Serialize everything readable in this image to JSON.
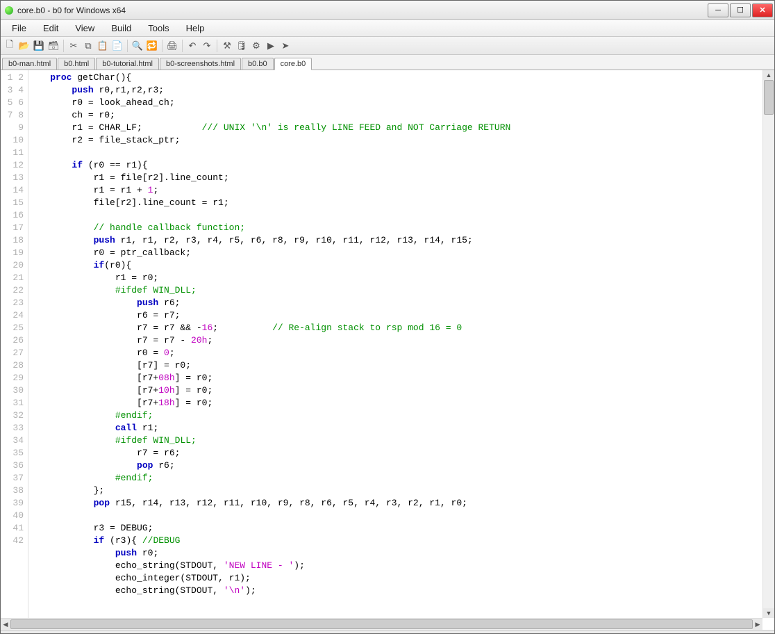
{
  "window": {
    "title": "core.b0 - b0 for Windows x64"
  },
  "menu": {
    "items": [
      "File",
      "Edit",
      "View",
      "Build",
      "Tools",
      "Help"
    ]
  },
  "toolbar_icons": [
    "new",
    "open",
    "save",
    "saveall",
    "|",
    "cut",
    "copy",
    "paste",
    "paste2",
    "|",
    "find",
    "replace",
    "|",
    "print",
    "|",
    "undo",
    "redo",
    "|",
    "compile",
    "db",
    "settings",
    "run",
    "debug"
  ],
  "tabs": {
    "items": [
      "b0-man.html",
      "b0.html",
      "b0-tutorial.html",
      "b0-screenshots.html",
      "b0.b0",
      "core.b0"
    ],
    "active_index": 5
  },
  "first_line_number": 1,
  "code_lines": [
    [
      [
        "",
        "    "
      ],
      [
        "kw",
        "proc"
      ],
      [
        "",
        " getChar(){"
      ]
    ],
    [
      [
        "",
        "        "
      ],
      [
        "kw",
        "push"
      ],
      [
        "",
        " r0,r1,r2,r3;"
      ]
    ],
    [
      [
        "",
        "        r0 = look_ahead_ch;"
      ]
    ],
    [
      [
        "",
        "        ch = r0;"
      ]
    ],
    [
      [
        "",
        "        r1 = CHAR_LF;           "
      ],
      [
        "cmt",
        "/// UNIX '\\n' is really LINE FEED and NOT Carriage RETURN"
      ]
    ],
    [
      [
        "",
        "        r2 = file_stack_ptr;"
      ]
    ],
    [
      [
        "",
        ""
      ]
    ],
    [
      [
        "",
        "        "
      ],
      [
        "kw",
        "if"
      ],
      [
        "",
        " (r0 == r1){"
      ]
    ],
    [
      [
        "",
        "            r1 = file[r2].line_count;"
      ]
    ],
    [
      [
        "",
        "            r1 = r1 + "
      ],
      [
        "num",
        "1"
      ],
      [
        "",
        ";"
      ]
    ],
    [
      [
        "",
        "            file[r2].line_count = r1;"
      ]
    ],
    [
      [
        "",
        ""
      ]
    ],
    [
      [
        "",
        "            "
      ],
      [
        "cmt",
        "// handle callback function;"
      ]
    ],
    [
      [
        "",
        "            "
      ],
      [
        "kw",
        "push"
      ],
      [
        "",
        " r1, r1, r2, r3, r4, r5, r6, r8, r9, r10, r11, r12, r13, r14, r15;"
      ]
    ],
    [
      [
        "",
        "            r0 = ptr_callback;"
      ]
    ],
    [
      [
        "",
        "            "
      ],
      [
        "kw",
        "if"
      ],
      [
        "",
        "(r0){"
      ]
    ],
    [
      [
        "",
        "                r1 = r0;"
      ]
    ],
    [
      [
        "",
        "                "
      ],
      [
        "pre",
        "#ifdef WIN_DLL;"
      ]
    ],
    [
      [
        "",
        "                    "
      ],
      [
        "kw",
        "push"
      ],
      [
        "",
        " r6;"
      ]
    ],
    [
      [
        "",
        "                    r6 = r7;"
      ]
    ],
    [
      [
        "",
        "                    r7 = r7 && -"
      ],
      [
        "num",
        "16"
      ],
      [
        "",
        ";          "
      ],
      [
        "cmt",
        "// Re-align stack to rsp mod 16 = 0"
      ]
    ],
    [
      [
        "",
        "                    r7 = r7 - "
      ],
      [
        "num",
        "20h"
      ],
      [
        "",
        ";"
      ]
    ],
    [
      [
        "",
        "                    r0 = "
      ],
      [
        "num",
        "0"
      ],
      [
        "",
        ";"
      ]
    ],
    [
      [
        "",
        "                    [r7] = r0;"
      ]
    ],
    [
      [
        "",
        "                    [r7+"
      ],
      [
        "num",
        "08h"
      ],
      [
        "",
        "] = r0;"
      ]
    ],
    [
      [
        "",
        "                    [r7+"
      ],
      [
        "num",
        "10h"
      ],
      [
        "",
        "] = r0;"
      ]
    ],
    [
      [
        "",
        "                    [r7+"
      ],
      [
        "num",
        "18h"
      ],
      [
        "",
        "] = r0;"
      ]
    ],
    [
      [
        "",
        "                "
      ],
      [
        "pre",
        "#endif;"
      ]
    ],
    [
      [
        "",
        "                "
      ],
      [
        "kw",
        "call"
      ],
      [
        "",
        " r1;"
      ]
    ],
    [
      [
        "",
        "                "
      ],
      [
        "pre",
        "#ifdef WIN_DLL;"
      ]
    ],
    [
      [
        "",
        "                    r7 = r6;"
      ]
    ],
    [
      [
        "",
        "                    "
      ],
      [
        "kw",
        "pop"
      ],
      [
        "",
        " r6;"
      ]
    ],
    [
      [
        "",
        "                "
      ],
      [
        "pre",
        "#endif;"
      ]
    ],
    [
      [
        "",
        "            };"
      ]
    ],
    [
      [
        "",
        "            "
      ],
      [
        "kw",
        "pop"
      ],
      [
        "",
        " r15, r14, r13, r12, r11, r10, r9, r8, r6, r5, r4, r3, r2, r1, r0;"
      ]
    ],
    [
      [
        "",
        ""
      ]
    ],
    [
      [
        "",
        "            r3 = DEBUG;"
      ]
    ],
    [
      [
        "",
        "            "
      ],
      [
        "kw",
        "if"
      ],
      [
        "",
        " (r3){ "
      ],
      [
        "cmt",
        "//DEBUG"
      ]
    ],
    [
      [
        "",
        "                "
      ],
      [
        "kw",
        "push"
      ],
      [
        "",
        " r0;"
      ]
    ],
    [
      [
        "",
        "                echo_string(STDOUT, "
      ],
      [
        "str",
        "'NEW LINE - '"
      ],
      [
        "",
        ");"
      ]
    ],
    [
      [
        "",
        "                echo_integer(STDOUT, r1);"
      ]
    ],
    [
      [
        "",
        "                echo_string(STDOUT, "
      ],
      [
        "str",
        "'\\n'"
      ],
      [
        "",
        ");"
      ]
    ]
  ]
}
